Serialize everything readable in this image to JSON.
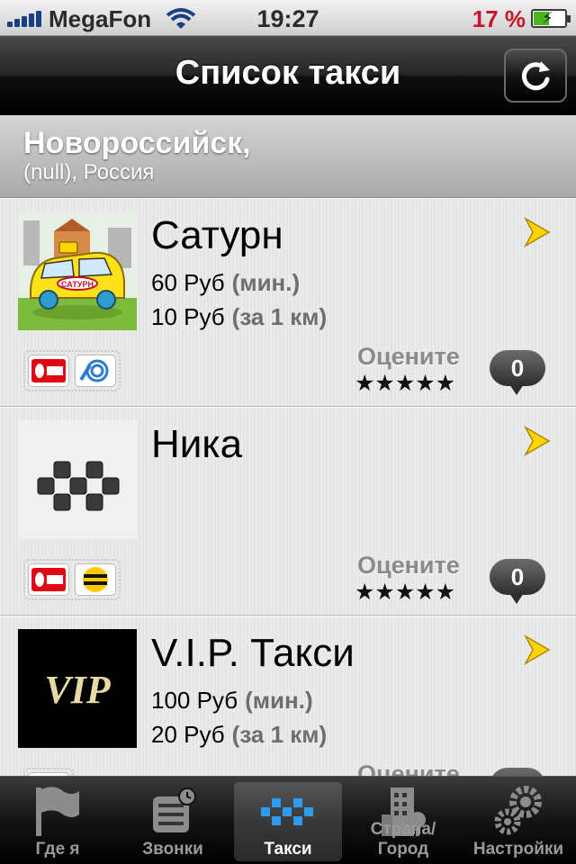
{
  "status_bar": {
    "carrier": "MegaFon",
    "time": "19:27",
    "battery_percent": "17 %",
    "battery_level": 0.17
  },
  "nav": {
    "title": "Список такси"
  },
  "city": {
    "name": "Новороссийск,",
    "region": "(null), Россия"
  },
  "taxis": [
    {
      "name": "Сатурн",
      "min_price": "60 Руб",
      "min_unit": "(мин.)",
      "km_price": "10 Руб",
      "km_unit": "(за 1 км)",
      "payments": [
        "МТС",
        "Мегафон"
      ],
      "rate_label": "Оцените",
      "stars": "★★★★★",
      "reviews": "0",
      "logo_text": "САТУРН"
    },
    {
      "name": "Ника",
      "min_price": "",
      "min_unit": "",
      "km_price": "",
      "km_unit": "",
      "payments": [
        "МТС",
        "Билайн"
      ],
      "rate_label": "Оцените",
      "stars": "★★★★★",
      "reviews": "0"
    },
    {
      "name": "V.I.P. Такси",
      "min_price": "100 Руб",
      "min_unit": "(мин.)",
      "km_price": "20 Руб",
      "km_unit": "(за 1 км)",
      "payments": [
        "Мегафон"
      ],
      "rate_label": "Оцените",
      "stars": "★★★★★",
      "reviews": "0",
      "logo_text": "VIP"
    }
  ],
  "tabs": [
    {
      "label": "Где я",
      "icon": "flag-icon"
    },
    {
      "label": "Звонки",
      "icon": "calls-icon"
    },
    {
      "label": "Такси",
      "icon": "taxi-checker-icon",
      "active": true
    },
    {
      "label": "Страна/Город",
      "icon": "building-icon"
    },
    {
      "label": "Настройки",
      "icon": "gears-icon"
    }
  ],
  "colors": {
    "accent_yellow": "#ffd400",
    "battery_red": "#c8152c",
    "battery_green": "#49b521"
  }
}
